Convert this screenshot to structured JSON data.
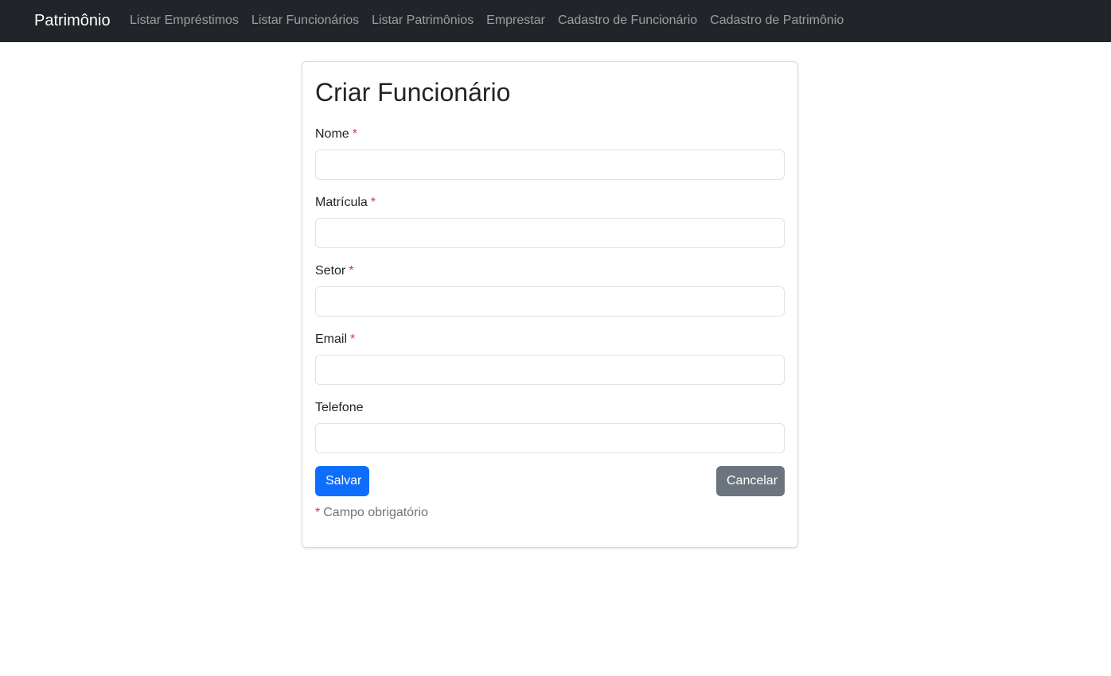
{
  "navbar": {
    "brand": "Patrimônio",
    "links": [
      "Listar Empréstimos",
      "Listar Funcionários",
      "Listar Patrimônios",
      "Emprestar",
      "Cadastro de Funcionário",
      "Cadastro de Patrimônio"
    ]
  },
  "form": {
    "title": "Criar Funcionário",
    "required_marker": "*",
    "fields": [
      {
        "label": "Nome",
        "value": "",
        "placeholder": ""
      },
      {
        "label": "Matrícula",
        "value": "",
        "placeholder": ""
      },
      {
        "label": "Setor",
        "value": "",
        "placeholder": ""
      },
      {
        "label": "Email",
        "value": "",
        "placeholder": ""
      },
      {
        "label": "Telefone",
        "value": "",
        "placeholder": ""
      }
    ],
    "save_label": "Salvar",
    "cancel_label": "Cancelar",
    "footnote": "Campo obrigatório"
  },
  "colors": {
    "navbar_bg": "#212529",
    "primary": "#0d6efd",
    "secondary": "#6c757d",
    "required": "#dc3545"
  }
}
